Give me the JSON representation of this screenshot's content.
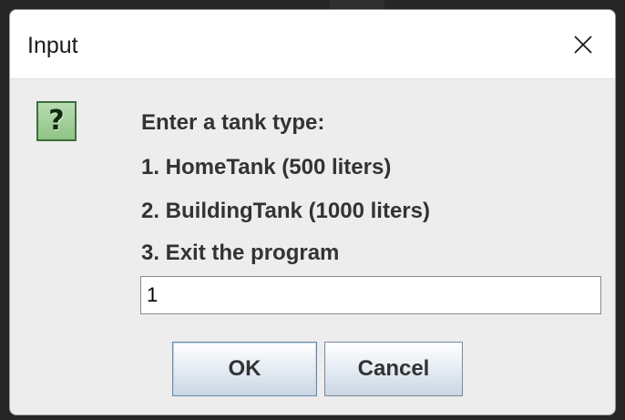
{
  "dialog": {
    "title": "Input",
    "message_lines": [
      "Enter a tank type:",
      "1. HomeTank (500 liters)",
      "2. BuildingTank (1000 liters)",
      "3. Exit the program"
    ],
    "input_value": "1",
    "ok_label": "OK",
    "cancel_label": "Cancel",
    "icon": "question-icon",
    "icon_glyph": "?"
  },
  "colors": {
    "dialog_bg": "#ededed",
    "titlebar_bg": "#ffffff",
    "icon_green": "#8fc384",
    "text": "#333333"
  }
}
